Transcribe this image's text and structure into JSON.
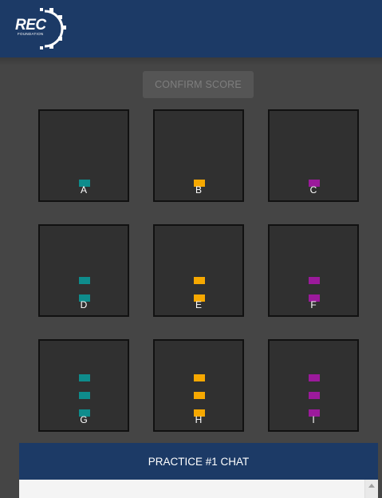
{
  "header": {
    "logo_text": "REC",
    "logo_subtext": "FOUNDATION",
    "background": "#1c3a66"
  },
  "confirm_button": {
    "label": "CONFIRM SCORE",
    "state": "disabled"
  },
  "colors": {
    "teal": "#0e8c8c",
    "orange": "#f6a800",
    "purple": "#9b1a9b",
    "tile_bg": "#303030"
  },
  "goals": [
    {
      "label": "A",
      "markers": 1,
      "color": "teal"
    },
    {
      "label": "B",
      "markers": 1,
      "color": "orange"
    },
    {
      "label": "C",
      "markers": 1,
      "color": "purple"
    },
    {
      "label": "D",
      "markers": 2,
      "color": "teal"
    },
    {
      "label": "E",
      "markers": 2,
      "color": "orange"
    },
    {
      "label": "F",
      "markers": 2,
      "color": "purple"
    },
    {
      "label": "G",
      "markers": 3,
      "color": "teal"
    },
    {
      "label": "H",
      "markers": 3,
      "color": "orange"
    },
    {
      "label": "I",
      "markers": 3,
      "color": "purple"
    }
  ],
  "chat": {
    "title": "PRACTICE #1 CHAT"
  }
}
